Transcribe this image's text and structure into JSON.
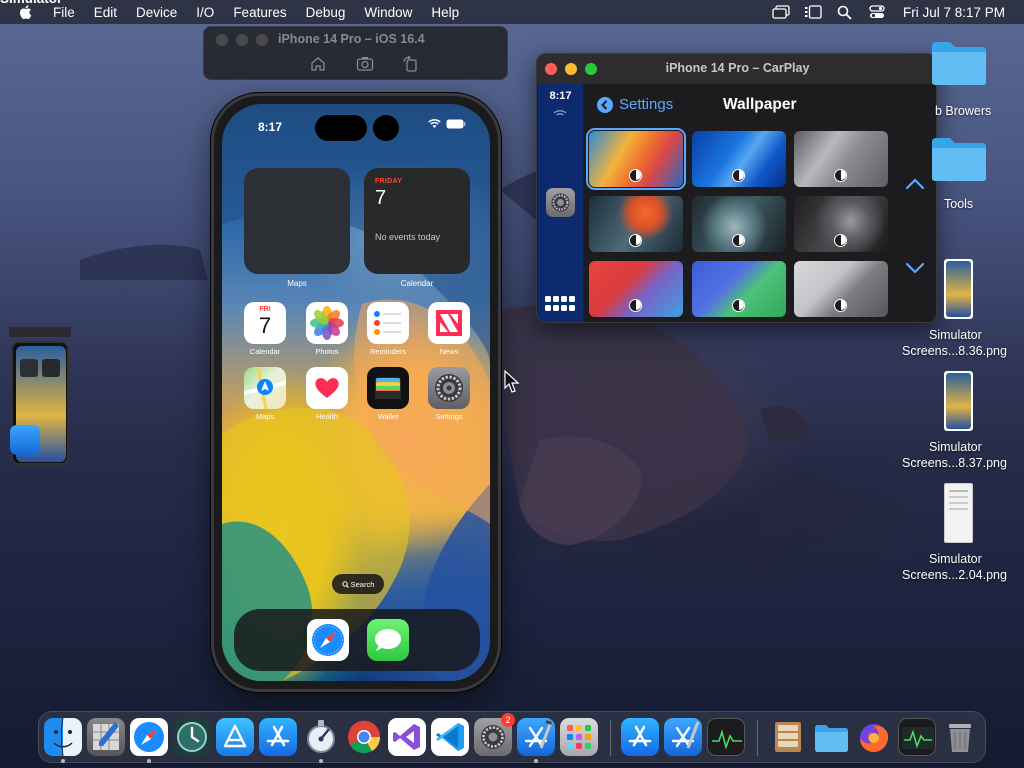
{
  "menubar": {
    "app_name": "Simulator",
    "items": [
      "File",
      "Edit",
      "Device",
      "I/O",
      "Features",
      "Debug",
      "Window",
      "Help"
    ],
    "clock": "Fri Jul 7  8:17 PM"
  },
  "simulator": {
    "title": "iPhone 14 Pro – iOS 16.4"
  },
  "phone": {
    "time": "8:17",
    "widgets": {
      "maps_label": "Maps",
      "calendar_label": "Calendar",
      "calendar_day": "FRIDAY",
      "calendar_date": "7",
      "calendar_events": "No events today"
    },
    "apps": [
      {
        "label": "Calendar",
        "icon": "calendar-icon"
      },
      {
        "label": "Photos",
        "icon": "photos-icon"
      },
      {
        "label": "Reminders",
        "icon": "reminders-icon"
      },
      {
        "label": "News",
        "icon": "news-icon"
      },
      {
        "label": "Maps",
        "icon": "maps-icon"
      },
      {
        "label": "Health",
        "icon": "health-icon"
      },
      {
        "label": "Wallet",
        "icon": "wallet-icon"
      },
      {
        "label": "Settings",
        "icon": "settings-icon"
      }
    ],
    "calendar_app_day": "FRI",
    "calendar_app_date": "7",
    "search_label": "Search",
    "dock_apps": [
      "safari-icon",
      "messages-icon"
    ]
  },
  "carplay": {
    "title": "iPhone 14 Pro – CarPlay",
    "time": "8:17",
    "back_label": "Settings",
    "heading": "Wallpaper"
  },
  "desktop": {
    "folders": [
      {
        "label": "b Browers"
      },
      {
        "label": "Tools"
      }
    ],
    "files": [
      {
        "line1": "Simulator",
        "line2": "Screens...8.36.png"
      },
      {
        "line1": "Simulator",
        "line2": "Screens...8.37.png"
      },
      {
        "line1": "Simulator",
        "line2": "Screens...2.04.png"
      }
    ]
  },
  "dock": {
    "settings_badge": "2",
    "apps": [
      "finder-icon",
      "script-editor-icon",
      "safari-icon",
      "time-machine-icon",
      "app-store-connect-icon",
      "app-store-icon",
      "instruments-icon",
      "chrome-icon",
      "visual-studio-icon",
      "vscode-icon",
      "system-settings-icon",
      "xcode-icon",
      "launchpad-icon",
      "app-store-icon-2",
      "xcode-icon-2",
      "activity-monitor-icon",
      "archive-utility-icon",
      "folder-icon",
      "firefox-icon",
      "activity-monitor-icon-2",
      "trash-icon"
    ]
  },
  "colors": {
    "accent": "#5aa8ff",
    "red_light": "#ff5f57",
    "yellow_light": "#febc2e",
    "green_light": "#28c840"
  }
}
